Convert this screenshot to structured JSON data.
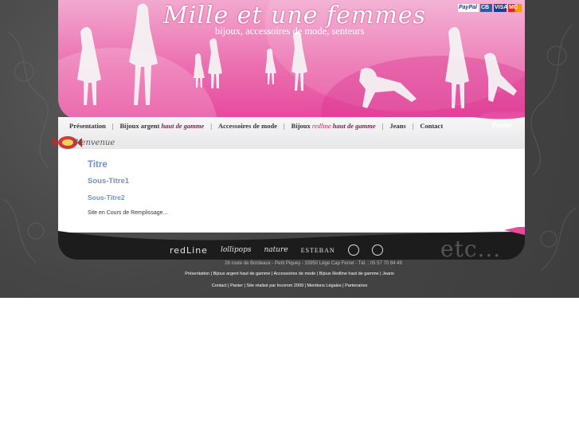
{
  "brand": {
    "name": "Mille et une femmes",
    "tagline": "bijoux, accessoires de mode, senteurs"
  },
  "payment": [
    "PayPal",
    "CB",
    "VISA",
    "MC"
  ],
  "menu": {
    "presentation": "Présentation",
    "bijoux_argent": "Bijoux argent",
    "haut_de_gamme": "haut de gamme",
    "accessoires": "Accessoires de mode",
    "bijoux": "Bijoux",
    "redline": "redline",
    "haut_de_gamme2": "haut de gamme",
    "jeans": "Jeans",
    "contact": "Contact",
    "sep": "|"
  },
  "panier": "Panier",
  "bienvenue": "Bienvenue",
  "content": {
    "titre": "Titre",
    "sous_titre1": "Sous-Titre1",
    "sous_titre2": "Sous-Titre2",
    "body": "Site en Cours de Remplissage..."
  },
  "brands": [
    "redLine",
    "lollipops",
    "nature",
    "ESTEBAN"
  ],
  "etc": "etc...",
  "footer": {
    "address": "26 route de Bordeaux  -  Petit Piquey  -  33950 Lège Cap Ferret  -  Tél. : 05 57 70 84 49",
    "links1": "Présentation | Bijoux argent haut de gamme | Accessoires de mode | Bijoux Redline haut de gamme | Jeans",
    "links2": "Contact | Panier | Site réalisé par Incomm 2009 | Mentions Légales | Partenaires"
  },
  "colors": {
    "pink": "#e64a9d",
    "title_blue": "#6f8fc6",
    "dark_bg": "#4a4a4a"
  }
}
